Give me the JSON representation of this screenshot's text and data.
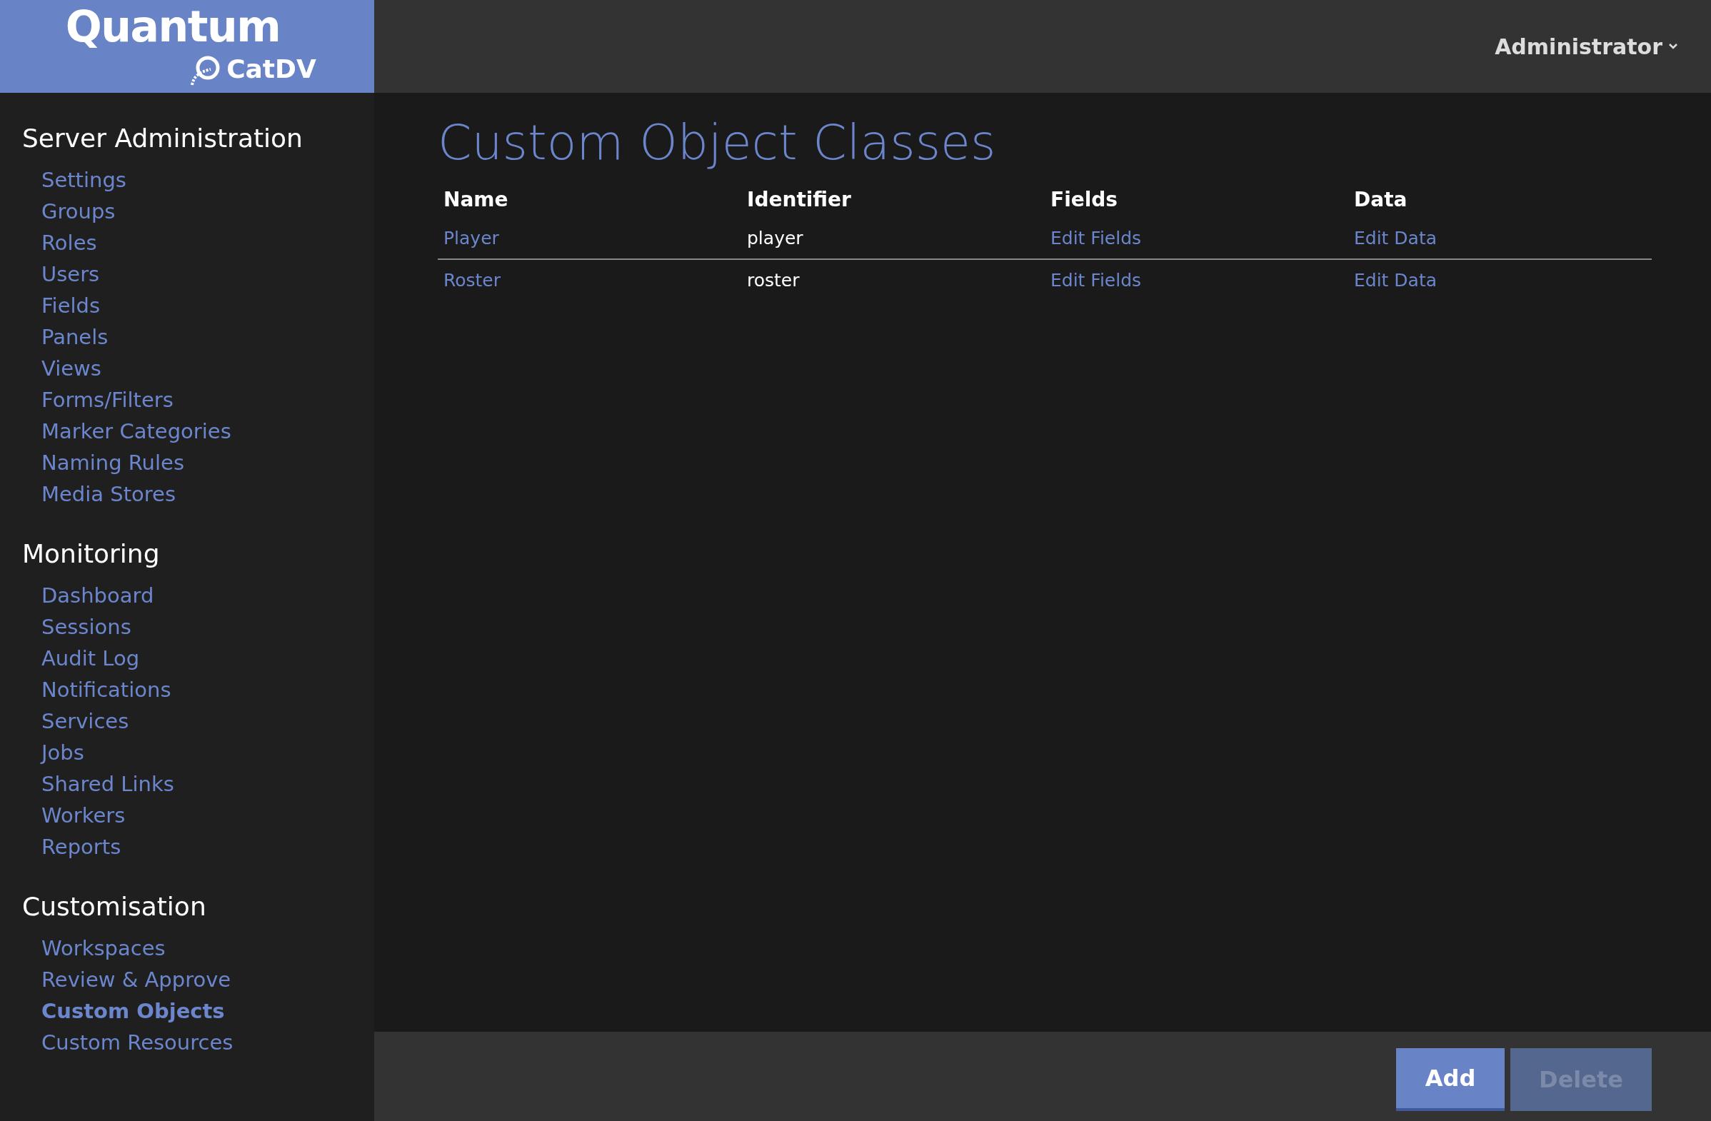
{
  "logo": {
    "brand": "Quantum",
    "product": "CatDV"
  },
  "user_menu": {
    "label": "Administrator"
  },
  "sidebar": {
    "sections": [
      {
        "title": "Server Administration",
        "items": [
          {
            "label": "Settings",
            "selected": false
          },
          {
            "label": "Groups",
            "selected": false
          },
          {
            "label": "Roles",
            "selected": false
          },
          {
            "label": "Users",
            "selected": false
          },
          {
            "label": "Fields",
            "selected": false
          },
          {
            "label": "Panels",
            "selected": false
          },
          {
            "label": "Views",
            "selected": false
          },
          {
            "label": "Forms/Filters",
            "selected": false
          },
          {
            "label": "Marker Categories",
            "selected": false
          },
          {
            "label": "Naming Rules",
            "selected": false
          },
          {
            "label": "Media Stores",
            "selected": false
          }
        ]
      },
      {
        "title": "Monitoring",
        "items": [
          {
            "label": "Dashboard",
            "selected": false
          },
          {
            "label": "Sessions",
            "selected": false
          },
          {
            "label": "Audit Log",
            "selected": false
          },
          {
            "label": "Notifications",
            "selected": false
          },
          {
            "label": "Services",
            "selected": false
          },
          {
            "label": "Jobs",
            "selected": false
          },
          {
            "label": "Shared Links",
            "selected": false
          },
          {
            "label": "Workers",
            "selected": false
          },
          {
            "label": "Reports",
            "selected": false
          }
        ]
      },
      {
        "title": "Customisation",
        "items": [
          {
            "label": "Workspaces",
            "selected": false
          },
          {
            "label": "Review & Approve",
            "selected": false
          },
          {
            "label": "Custom Objects",
            "selected": true
          },
          {
            "label": "Custom Resources",
            "selected": false
          }
        ]
      }
    ]
  },
  "page": {
    "title": "Custom Object Classes"
  },
  "table": {
    "columns": [
      "Name",
      "Identifier",
      "Fields",
      "Data"
    ],
    "rows": [
      {
        "name": "Player",
        "identifier": "player",
        "fields": "Edit Fields",
        "data": "Edit Data",
        "selected": false
      },
      {
        "name": "Roster",
        "identifier": "roster",
        "fields": "Edit Fields",
        "data": "Edit Data",
        "selected": false
      }
    ]
  },
  "buttons": [
    {
      "label": "Add",
      "disabled": false
    },
    {
      "label": "Delete",
      "disabled": true
    }
  ]
}
